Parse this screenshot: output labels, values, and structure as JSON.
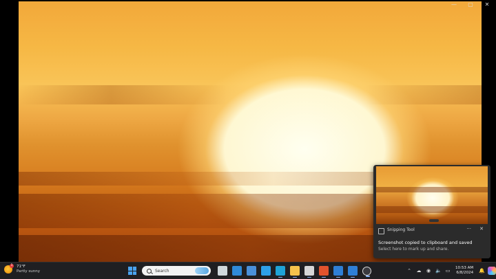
{
  "window": {
    "controls": {
      "minimize": "—",
      "maximize": "▢",
      "close": "✕"
    }
  },
  "toast": {
    "app_name": "Snipping Tool",
    "more": "···",
    "close": "✕",
    "title": "Screenshot copied to clipboard and saved",
    "subtitle": "Select here to mark up and share."
  },
  "taskbar": {
    "weather": {
      "temperature": "71°F",
      "condition": "Partly sunny",
      "badge": "1"
    },
    "search": {
      "label": "Search"
    },
    "apps": [
      {
        "name": "task-view-icon",
        "color": "#cfd8dc"
      },
      {
        "name": "widgets-app-icon",
        "color": "#2f8ad8"
      },
      {
        "name": "notepad-app-icon",
        "color": "#4a90d9"
      },
      {
        "name": "photos-app-icon",
        "color": "#2ea0e8"
      },
      {
        "name": "edge-browser-icon",
        "color": "#1fa3d6"
      },
      {
        "name": "file-explorer-icon",
        "color": "#f5c24c"
      },
      {
        "name": "media-app-icon",
        "color": "#d6d6d6"
      },
      {
        "name": "brave-browser-icon",
        "color": "#e2532d"
      },
      {
        "name": "mail-app-icon",
        "color": "#2f7fd6"
      },
      {
        "name": "calendar-app-icon",
        "color": "#2f7fd6"
      },
      {
        "name": "media-player-icon",
        "color": "#3a3a3f"
      }
    ],
    "tray": {
      "chevron": "⌃",
      "cloud": "☁",
      "wifi": "◉",
      "volume": "🔈",
      "battery": "▭",
      "time": "10:53 AM",
      "date": "6/8/2024",
      "bell": "🔔"
    }
  }
}
